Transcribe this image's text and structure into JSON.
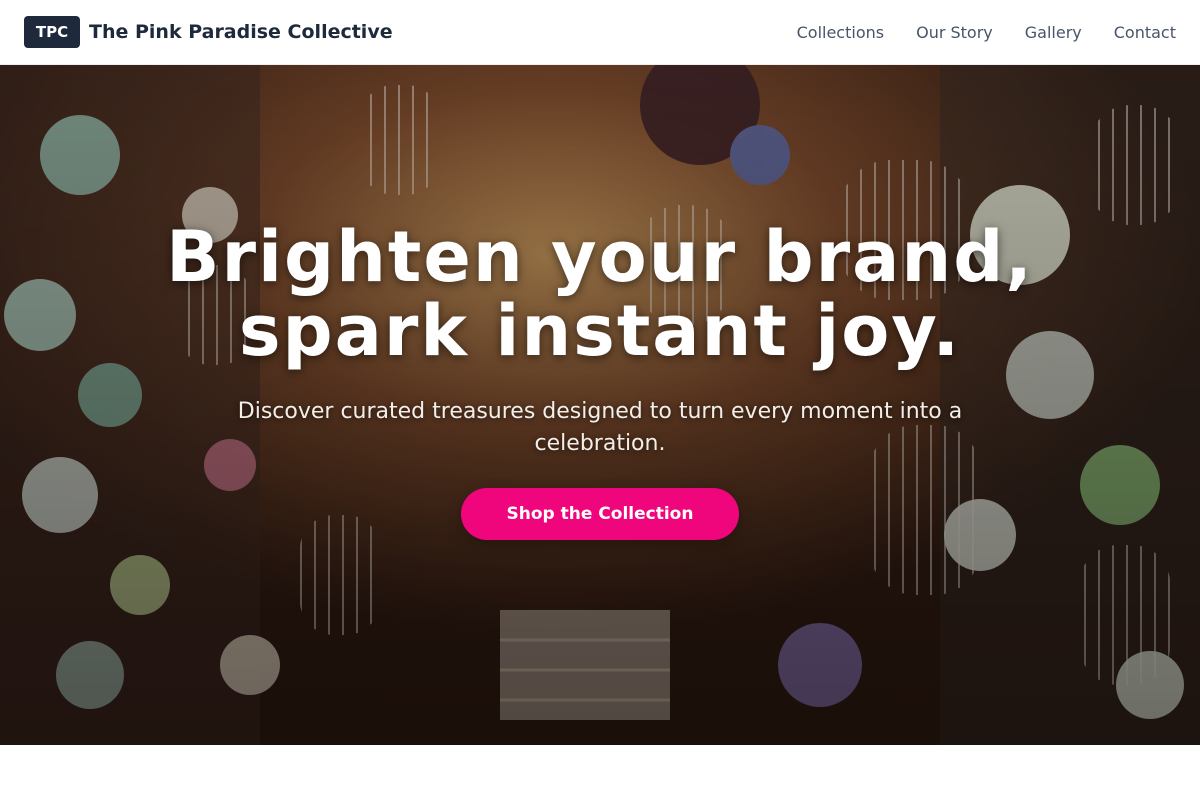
{
  "nav": {
    "logo_badge": "TPC",
    "brand_name": "The Pink Paradise Collective",
    "links": [
      "Collections",
      "Our Story",
      "Gallery",
      "Contact"
    ]
  },
  "hero": {
    "title": "Brighten your brand, spark instant joy.",
    "subtitle": "Discover curated treasures designed to turn every moment into a celebration.",
    "cta_label": "Shop the Collection"
  },
  "colors": {
    "brand_dark": "#1e293b",
    "nav_link": "#475569",
    "cta_pink": "#f0067c"
  }
}
